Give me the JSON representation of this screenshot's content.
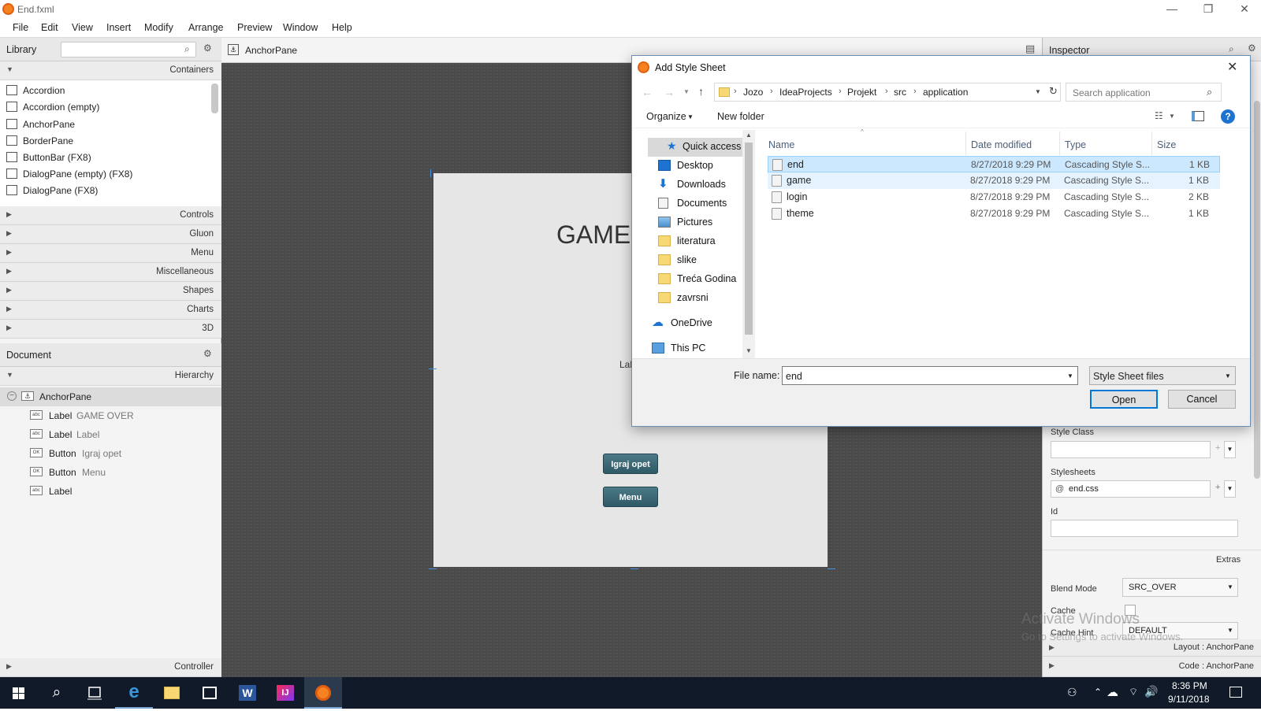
{
  "window": {
    "title": "End.fxml"
  },
  "menu": [
    "File",
    "Edit",
    "View",
    "Insert",
    "Modify",
    "Arrange",
    "Preview",
    "Window",
    "Help"
  ],
  "library": {
    "title": "Library",
    "containers_label": "Containers",
    "items": [
      "Accordion",
      "Accordion  (empty)",
      "AnchorPane",
      "BorderPane",
      "ButtonBar  (FX8)",
      "DialogPane (empty)  (FX8)",
      "DialogPane  (FX8)"
    ],
    "sections": [
      "Controls",
      "Gluon",
      "Menu",
      "Miscellaneous",
      "Shapes",
      "Charts",
      "3D"
    ]
  },
  "document": {
    "title": "Document",
    "hierarchy_label": "Hierarchy",
    "root": "AnchorPane",
    "nodes": [
      {
        "type": "Label",
        "text": "GAME OVER",
        "icon": "abc"
      },
      {
        "type": "Label",
        "text": "Label",
        "icon": "abc"
      },
      {
        "type": "Button",
        "text": "Igraj opet",
        "icon": "OK"
      },
      {
        "type": "Button",
        "text": "Menu",
        "icon": "OK"
      },
      {
        "type": "Label",
        "text": "",
        "icon": "abc"
      }
    ],
    "controller_label": "Controller"
  },
  "breadcrumb": "AnchorPane",
  "artboard": {
    "title_text": "GAME",
    "label_fragment": "Lal",
    "button1": "Igraj opet",
    "button2": "Menu"
  },
  "inspector": {
    "title": "Inspector",
    "style_class_label": "Style Class",
    "stylesheets_label": "Stylesheets",
    "stylesheet_value": "end.css",
    "id_label": "Id",
    "extras_label": "Extras",
    "blend_mode_label": "Blend Mode",
    "blend_mode_value": "SRC_OVER",
    "cache_label": "Cache",
    "cache_hint_label": "Cache Hint",
    "cache_hint_value": "DEFAULT",
    "layout_label": "Layout : AnchorPane",
    "code_label": "Code : AnchorPane"
  },
  "watermark": {
    "line1": "Activate Windows",
    "line2": "Go to Settings to activate Windows."
  },
  "dialog": {
    "title": "Add Style Sheet",
    "path": [
      "Jozo",
      "IdeaProjects",
      "Projekt",
      "src",
      "application"
    ],
    "search_placeholder": "Search application",
    "organize": "Organize",
    "new_folder": "New folder",
    "nav": [
      {
        "label": "Quick access",
        "icon": "star-icon",
        "pinned": false
      },
      {
        "label": "Desktop",
        "icon": "desktop-icon",
        "pinned": true
      },
      {
        "label": "Downloads",
        "icon": "download-icon",
        "pinned": true
      },
      {
        "label": "Documents",
        "icon": "documents-icon",
        "pinned": true
      },
      {
        "label": "Pictures",
        "icon": "pictures-icon",
        "pinned": true
      },
      {
        "label": "literatura",
        "icon": "folder-icon",
        "pinned": false
      },
      {
        "label": "slike",
        "icon": "folder-icon",
        "pinned": false
      },
      {
        "label": "Treća Godina",
        "icon": "folder-icon",
        "pinned": false
      },
      {
        "label": "zavrsni",
        "icon": "folder-icon",
        "pinned": false
      },
      {
        "label": "OneDrive",
        "icon": "cloud-icon",
        "pinned": false
      },
      {
        "label": "This PC",
        "icon": "pc-icon",
        "pinned": false
      }
    ],
    "columns": {
      "name": "Name",
      "date": "Date modified",
      "type": "Type",
      "size": "Size"
    },
    "files": [
      {
        "name": "end",
        "date": "8/27/2018 9:29 PM",
        "type": "Cascading Style S...",
        "size": "1 KB",
        "selected": true
      },
      {
        "name": "game",
        "date": "8/27/2018 9:29 PM",
        "type": "Cascading Style S...",
        "size": "1 KB",
        "selected": false
      },
      {
        "name": "login",
        "date": "8/27/2018 9:29 PM",
        "type": "Cascading Style S...",
        "size": "2 KB",
        "selected": false
      },
      {
        "name": "theme",
        "date": "8/27/2018 9:29 PM",
        "type": "Cascading Style S...",
        "size": "1 KB",
        "selected": false
      }
    ],
    "file_name_label": "File name:",
    "file_name_value": "end",
    "filter": "Style Sheet files",
    "open": "Open",
    "cancel": "Cancel"
  },
  "taskbar": {
    "time": "8:36 PM",
    "date": "9/11/2018"
  },
  "colors": {
    "accent": "#0078d7",
    "selection": "#cce8ff",
    "fx_button": "#3a6a76"
  }
}
